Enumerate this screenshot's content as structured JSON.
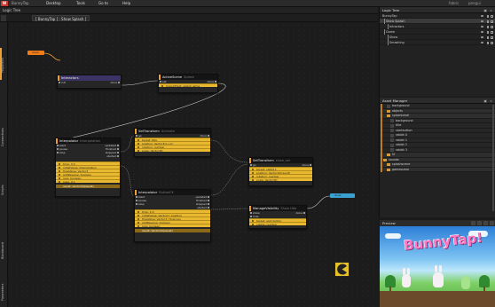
{
  "menubar": {
    "logo": "W",
    "app_name": "BunnyTap",
    "items": [
      "Desktop",
      "Tools",
      "Go to",
      "Help"
    ],
    "right_items": [
      "fabric",
      "pengui"
    ]
  },
  "titlebar": {
    "title": "Logic Tree"
  },
  "pathbar": {
    "breadcrumb": "[ BunnyTap ] : Show Splash ]"
  },
  "left_tabs": [
    "Properties",
    "Connections",
    "Scripts",
    "Blackboard",
    "Parameters"
  ],
  "nodes": {
    "show_pill": {
      "label": "show"
    },
    "interactors": {
      "title": "Interactors",
      "in_label": "init",
      "out_label": "done"
    },
    "active_scene": {
      "title": "ActiveScene",
      "sub": "Splash",
      "in_label": "set",
      "out_label": "done",
      "param": "SceneToSet: splash game"
    },
    "set_transform_1": {
      "title": "SetTransform",
      "sub": "Animate",
      "in_label": "go",
      "out_label": "done",
      "params": [
        "target: title",
        "position: Vector3(x,y,z)",
        "rotation: number",
        "scale: Vector3D"
      ]
    },
    "interpolator_1": {
      "title": "Interpolator",
      "sub": "Interpolation",
      "ins": [
        "start",
        "pause",
        "stop"
      ],
      "outs": [
        "updated",
        "finished",
        "stopped",
        "started"
      ],
      "params": [
        "time: 3.0",
        "initialValue: Interpolation",
        "finalValue: Vector3",
        "addReverse: boolean",
        "loop: boolean",
        "ease: 0.1"
      ],
      "result": "result: Vector3d(result)"
    },
    "interpolator_2": {
      "title": "Interpolator",
      "sub": "ButtonFX",
      "ins": [
        "start",
        "pause",
        "stop"
      ],
      "outs": [
        "updated",
        "finished",
        "stopped",
        "started"
      ],
      "params": [
        "time: 2.0",
        "initialValue: Vector3 | position",
        "finalValue: Vector3 | final pos",
        "addReverse: boolean",
        "loop: boolean"
      ],
      "result": "result: Vector3d(result)"
    },
    "set_transform_2": {
      "title": "SetTransform",
      "sub": "show_ser",
      "in_label": "go",
      "out_label": "done",
      "params": [
        "target: rabbit 1",
        "position: Vector3d(result)",
        "rotation: number",
        "scale: Vector3D"
      ]
    },
    "manage_visibility": {
      "title": "ManageVisibility",
      "sub": "Show title",
      "ins": [
        "show",
        "hide"
      ],
      "outs": [
        "done"
      ],
      "params": [
        "target: spot button",
        "visible: number"
      ]
    },
    "done_pill": {
      "label": "done"
    }
  },
  "logic_tree": {
    "title": "Logic Tree",
    "rows": [
      {
        "label": "BunnyTap",
        "indent": 0,
        "selected": false
      },
      {
        "label": "Show Splash",
        "indent": 1,
        "selected": true
      },
      {
        "label": "Intractors",
        "indent": 2,
        "selected": false
      },
      {
        "label": "Game",
        "indent": 1,
        "selected": false
      },
      {
        "label": "Show",
        "indent": 2,
        "selected": false
      },
      {
        "label": "Smashing",
        "indent": 2,
        "selected": false
      }
    ]
  },
  "asset_manager": {
    "title": "Asset Manager",
    "rows": [
      {
        "label": "background",
        "kind": "thumb",
        "indent": 1
      },
      {
        "label": "objects",
        "kind": "folder",
        "indent": 1
      },
      {
        "label": "splashLevel",
        "kind": "folder",
        "indent": 1
      },
      {
        "label": "background",
        "kind": "thumb",
        "indent": 2
      },
      {
        "label": "title",
        "kind": "thumb",
        "indent": 2
      },
      {
        "label": "startbutton",
        "kind": "thumb",
        "indent": 2
      },
      {
        "label": "rabbit 0",
        "kind": "thumb",
        "indent": 2
      },
      {
        "label": "rabbit 1",
        "kind": "thumb",
        "indent": 2
      },
      {
        "label": "rabbit 2",
        "kind": "thumb",
        "indent": 2
      },
      {
        "label": "rabbit 3",
        "kind": "thumb",
        "indent": 2
      },
      {
        "label": "UI",
        "kind": "folder",
        "indent": 1
      },
      {
        "label": "sounds",
        "kind": "folder",
        "indent": 0
      },
      {
        "label": "splashscene",
        "kind": "folder",
        "indent": 1
      },
      {
        "label": "gamescene",
        "kind": "folder",
        "indent": 1
      }
    ]
  },
  "preview": {
    "title": "Preview",
    "game_logo": "BunnyTap!"
  },
  "colors": {
    "accent_orange": "#f07b17",
    "param_yellow": "#e8b930",
    "selected_header": "#3a3566",
    "blue_pill": "#3aa0d0"
  }
}
